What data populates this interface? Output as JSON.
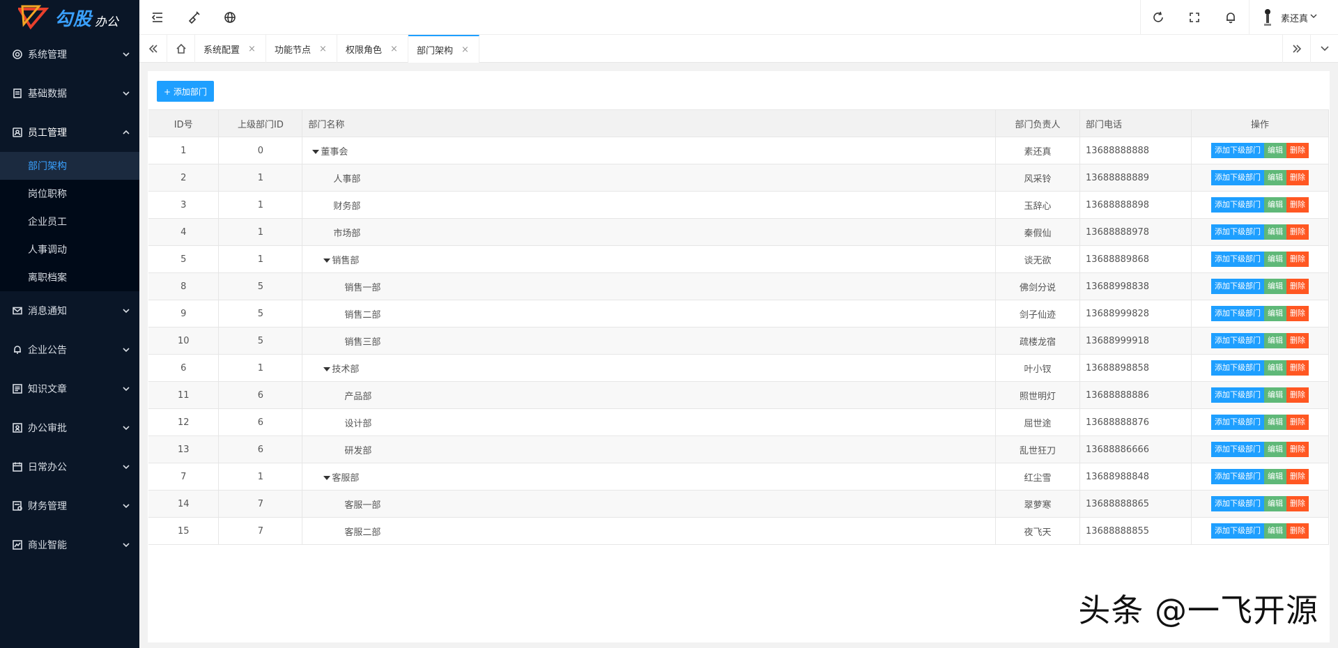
{
  "brand": {
    "name": "勾股",
    "suffix": "办公",
    "mark": "OA"
  },
  "sidebar": {
    "items": [
      {
        "label": "系统管理",
        "icon": "settings-icon"
      },
      {
        "label": "基础数据",
        "icon": "document-icon"
      },
      {
        "label": "员工管理",
        "icon": "user-card-icon",
        "open": true,
        "children": [
          {
            "label": "部门架构",
            "active": true
          },
          {
            "label": "岗位职称"
          },
          {
            "label": "企业员工"
          },
          {
            "label": "人事调动"
          },
          {
            "label": "离职档案"
          }
        ]
      },
      {
        "label": "消息通知",
        "icon": "mail-icon"
      },
      {
        "label": "企业公告",
        "icon": "bell-icon"
      },
      {
        "label": "知识文章",
        "icon": "article-icon"
      },
      {
        "label": "办公审批",
        "icon": "approval-icon"
      },
      {
        "label": "日常办公",
        "icon": "calendar-icon"
      },
      {
        "label": "财务管理",
        "icon": "finance-icon"
      },
      {
        "label": "商业智能",
        "icon": "chart-icon"
      }
    ]
  },
  "header": {
    "user_name": "素还真"
  },
  "tabs": {
    "items": [
      {
        "label": "系统配置",
        "active": false
      },
      {
        "label": "功能节点",
        "active": false
      },
      {
        "label": "权限角色",
        "active": false
      },
      {
        "label": "部门架构",
        "active": true
      }
    ],
    "close_glyph": "×"
  },
  "toolbar": {
    "add_label": "+ 添加部门"
  },
  "table": {
    "columns": [
      "ID号",
      "上级部门ID",
      "部门名称",
      "部门负责人",
      "部门电话",
      "操作"
    ],
    "op_labels": {
      "add": "添加下级部门",
      "edit": "编辑",
      "del": "删除"
    },
    "rows": [
      {
        "id": "1",
        "pid": "0",
        "name": "董事会",
        "level": 0,
        "expand": true,
        "leader": "素还真",
        "phone": "13688888888"
      },
      {
        "id": "2",
        "pid": "1",
        "name": "人事部",
        "level": 1,
        "expand": false,
        "leader": "风采铃",
        "phone": "13688888889"
      },
      {
        "id": "3",
        "pid": "1",
        "name": "财务部",
        "level": 1,
        "expand": false,
        "leader": "玉辞心",
        "phone": "13688888898"
      },
      {
        "id": "4",
        "pid": "1",
        "name": "市场部",
        "level": 1,
        "expand": false,
        "leader": "秦假仙",
        "phone": "13688888978"
      },
      {
        "id": "5",
        "pid": "1",
        "name": "销售部",
        "level": 1,
        "expand": true,
        "leader": "谈无欲",
        "phone": "13688889868"
      },
      {
        "id": "8",
        "pid": "5",
        "name": "销售一部",
        "level": 2,
        "expand": false,
        "leader": "佛剑分说",
        "phone": "13688998838"
      },
      {
        "id": "9",
        "pid": "5",
        "name": "销售二部",
        "level": 2,
        "expand": false,
        "leader": "剑子仙迹",
        "phone": "13688999828"
      },
      {
        "id": "10",
        "pid": "5",
        "name": "销售三部",
        "level": 2,
        "expand": false,
        "leader": "疏楼龙宿",
        "phone": "13688999918"
      },
      {
        "id": "6",
        "pid": "1",
        "name": "技术部",
        "level": 1,
        "expand": true,
        "leader": "叶小钗",
        "phone": "13688898858"
      },
      {
        "id": "11",
        "pid": "6",
        "name": "产品部",
        "level": 2,
        "expand": false,
        "leader": "照世明灯",
        "phone": "13688888886"
      },
      {
        "id": "12",
        "pid": "6",
        "name": "设计部",
        "level": 2,
        "expand": false,
        "leader": "屈世途",
        "phone": "13688888876"
      },
      {
        "id": "13",
        "pid": "6",
        "name": "研发部",
        "level": 2,
        "expand": false,
        "leader": "乱世狂刀",
        "phone": "13688886666"
      },
      {
        "id": "7",
        "pid": "1",
        "name": "客服部",
        "level": 1,
        "expand": true,
        "leader": "红尘雪",
        "phone": "13688988848"
      },
      {
        "id": "14",
        "pid": "7",
        "name": "客服一部",
        "level": 2,
        "expand": false,
        "leader": "翠萝寒",
        "phone": "13688888865"
      },
      {
        "id": "15",
        "pid": "7",
        "name": "客服二部",
        "level": 2,
        "expand": false,
        "leader": "夜飞天",
        "phone": "13688888855"
      }
    ]
  },
  "watermark": "头条 @一飞开源",
  "colors": {
    "sidebar_bg": "#0a1627",
    "accent": "#1e9fff",
    "edit": "#5fb878",
    "danger": "#ff5722"
  }
}
